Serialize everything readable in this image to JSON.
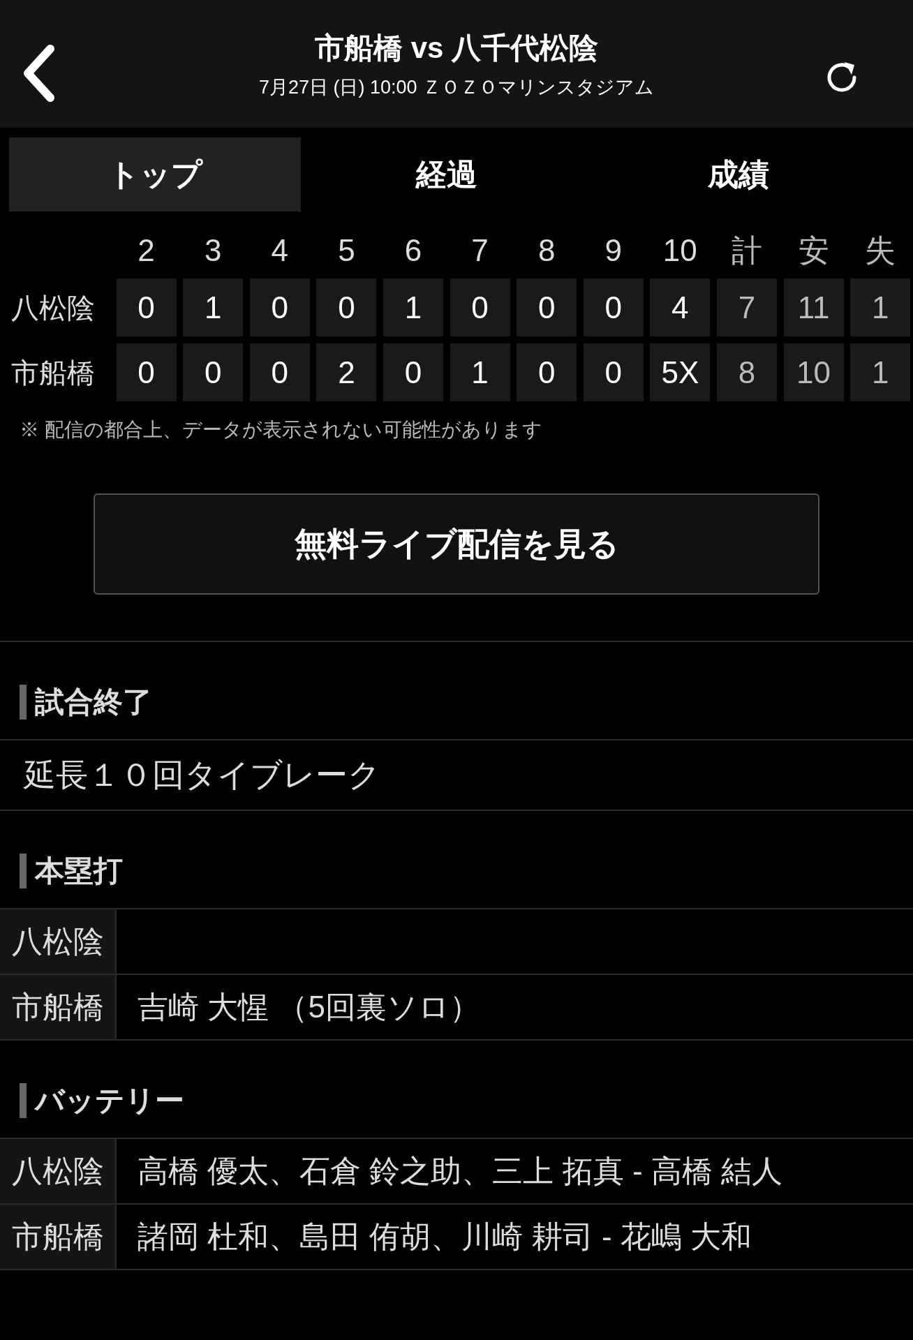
{
  "header": {
    "title": "市船橋 vs 八千代松陰",
    "subtitle": "7月27日 (日) 10:00 ＺＯＺＯマリンスタジアム"
  },
  "tabs": [
    {
      "label": "トップ",
      "selected": true
    },
    {
      "label": "経過",
      "selected": false
    },
    {
      "label": "成績",
      "selected": false
    }
  ],
  "scoreboard": {
    "columns": [
      {
        "label": "2",
        "kind": "inning"
      },
      {
        "label": "3",
        "kind": "inning"
      },
      {
        "label": "4",
        "kind": "inning"
      },
      {
        "label": "5",
        "kind": "inning"
      },
      {
        "label": "6",
        "kind": "inning"
      },
      {
        "label": "7",
        "kind": "inning"
      },
      {
        "label": "8",
        "kind": "inning"
      },
      {
        "label": "9",
        "kind": "inning"
      },
      {
        "label": "10",
        "kind": "inning"
      },
      {
        "label": "計",
        "kind": "total"
      },
      {
        "label": "安",
        "kind": "total"
      },
      {
        "label": "失",
        "kind": "total"
      }
    ],
    "rows": [
      {
        "team": "八松陰",
        "cells": [
          "0",
          "1",
          "0",
          "0",
          "1",
          "0",
          "0",
          "0",
          "4",
          "7",
          "11",
          "1"
        ]
      },
      {
        "team": "市船橋",
        "cells": [
          "0",
          "0",
          "0",
          "2",
          "0",
          "1",
          "0",
          "0",
          "5X",
          "8",
          "10",
          "1"
        ]
      }
    ],
    "note": "※ 配信の都合上、データが表示されない可能性があります"
  },
  "live_button": "無料ライブ配信を見る",
  "sections": [
    {
      "title": "試合終了",
      "kind": "text",
      "lines": [
        "延長１０回タイブレーク"
      ]
    },
    {
      "title": "本塁打",
      "kind": "table",
      "rows": [
        {
          "team": "八松陰"
        },
        {
          "team": "市船橋",
          "text": "吉崎 大惺 （5回裏ソロ）"
        }
      ]
    },
    {
      "title": "バッテリー",
      "kind": "table",
      "rows": [
        {
          "team": "八松陰",
          "text": "高橋 優太、石倉 鈴之助、三上 拓真 - 高橋 結人"
        },
        {
          "team": "市船橋",
          "text": "諸岡 杜和、島田 侑胡、川崎 耕司 - 花嶋 大和"
        }
      ]
    }
  ]
}
